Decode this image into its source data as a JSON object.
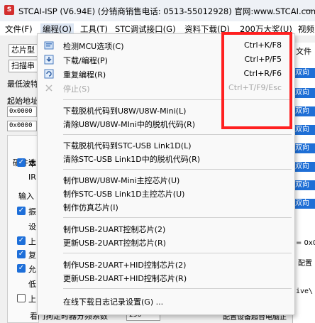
{
  "window": {
    "logo": "S",
    "title": "STCAI-ISP (V6.94E) (分销商销售电话: 0513-55012928) 官网:www.STCAI.com",
    "controls": "—"
  },
  "menubar": {
    "items": [
      {
        "label": "文件(F)"
      },
      {
        "label": "编程(O)"
      },
      {
        "label": "工具(T)"
      },
      {
        "label": "STC调试接口(G)"
      },
      {
        "label": "资料下载(D)"
      },
      {
        "label": "200万大奖(U)"
      },
      {
        "label": "视频"
      }
    ]
  },
  "background": {
    "chip_label": "芯片型",
    "scan_label": "扫描串",
    "baud_label": "最低波特",
    "start_addr_label": "起始地址",
    "hex1": "0x0000",
    "hex2": "0x0000",
    "hw_tab_label": "硬件选",
    "opt1": "本",
    "opt1_sub": "IR",
    "input_label": "输入",
    "opt2": "振",
    "opt2_sub": "设",
    "opt3": "上",
    "opt4": "复",
    "opt5": "允",
    "opt5_sub": "低",
    "opt6": "上",
    "bottom_label": "看门狗定时器分频系数",
    "bottom_value": "256",
    "right_file_label": "文件",
    "right_cells": [
      "双向",
      "双向",
      "双向",
      "双向",
      "双向",
      "双向",
      "双向",
      "双向"
    ],
    "right_text1": "= 0x0",
    "right_text2": "配置",
    "right_text3": "ive\\",
    "right_text4": "配置设备超台电脑正",
    "chk_mark": "✓"
  },
  "dropdown": {
    "items": [
      {
        "label": "检测MCU选项(C)",
        "shortcut": "Ctrl+K/F8",
        "icon": "detect-icon",
        "disabled": false
      },
      {
        "label": "下载/编程(P)",
        "shortcut": "Ctrl+P/F5",
        "icon": "download-icon",
        "disabled": false
      },
      {
        "label": "重复编程(R)",
        "shortcut": "Ctrl+R/F6",
        "icon": "repeat-icon",
        "disabled": false
      },
      {
        "label": "停止(S)",
        "shortcut": "Ctrl+T/F9/Esc",
        "icon": "stop-icon",
        "disabled": true
      },
      {
        "label": "下载脱机代码到U8W/U8W-Mini(L)",
        "shortcut": "",
        "disabled": false
      },
      {
        "label": "清除U8W/U8W-MIni中的脱机代码(R)",
        "shortcut": "",
        "disabled": false
      },
      {
        "label": "下载脱机代码到STC-USB Link1D(L)",
        "shortcut": "",
        "disabled": false
      },
      {
        "label": "清除STC-USB Link1D中的脱机代码(R)",
        "shortcut": "",
        "disabled": false
      },
      {
        "label": "制作U8W/U8W-Mini主控芯片(U)",
        "shortcut": "",
        "disabled": false
      },
      {
        "label": "制作STC-USB Link1D主控芯片(U)",
        "shortcut": "",
        "disabled": false
      },
      {
        "label": "制作仿真芯片(I)",
        "shortcut": "",
        "disabled": false
      },
      {
        "label": "制作USB-2UART控制芯片(2)",
        "shortcut": "",
        "disabled": false
      },
      {
        "label": "更新USB-2UART控制芯片(R)",
        "shortcut": "",
        "disabled": false
      },
      {
        "label": "制作USB-2UART+HID控制芯片(2)",
        "shortcut": "",
        "disabled": false
      },
      {
        "label": "更新USB-2UART+HID控制芯片(R)",
        "shortcut": "",
        "disabled": false
      },
      {
        "label": "在线下载日志记录设置(G) ...",
        "shortcut": "",
        "disabled": false
      }
    ]
  },
  "colors": {
    "highlight": "#ff2020",
    "accent": "#1f6fd6"
  }
}
